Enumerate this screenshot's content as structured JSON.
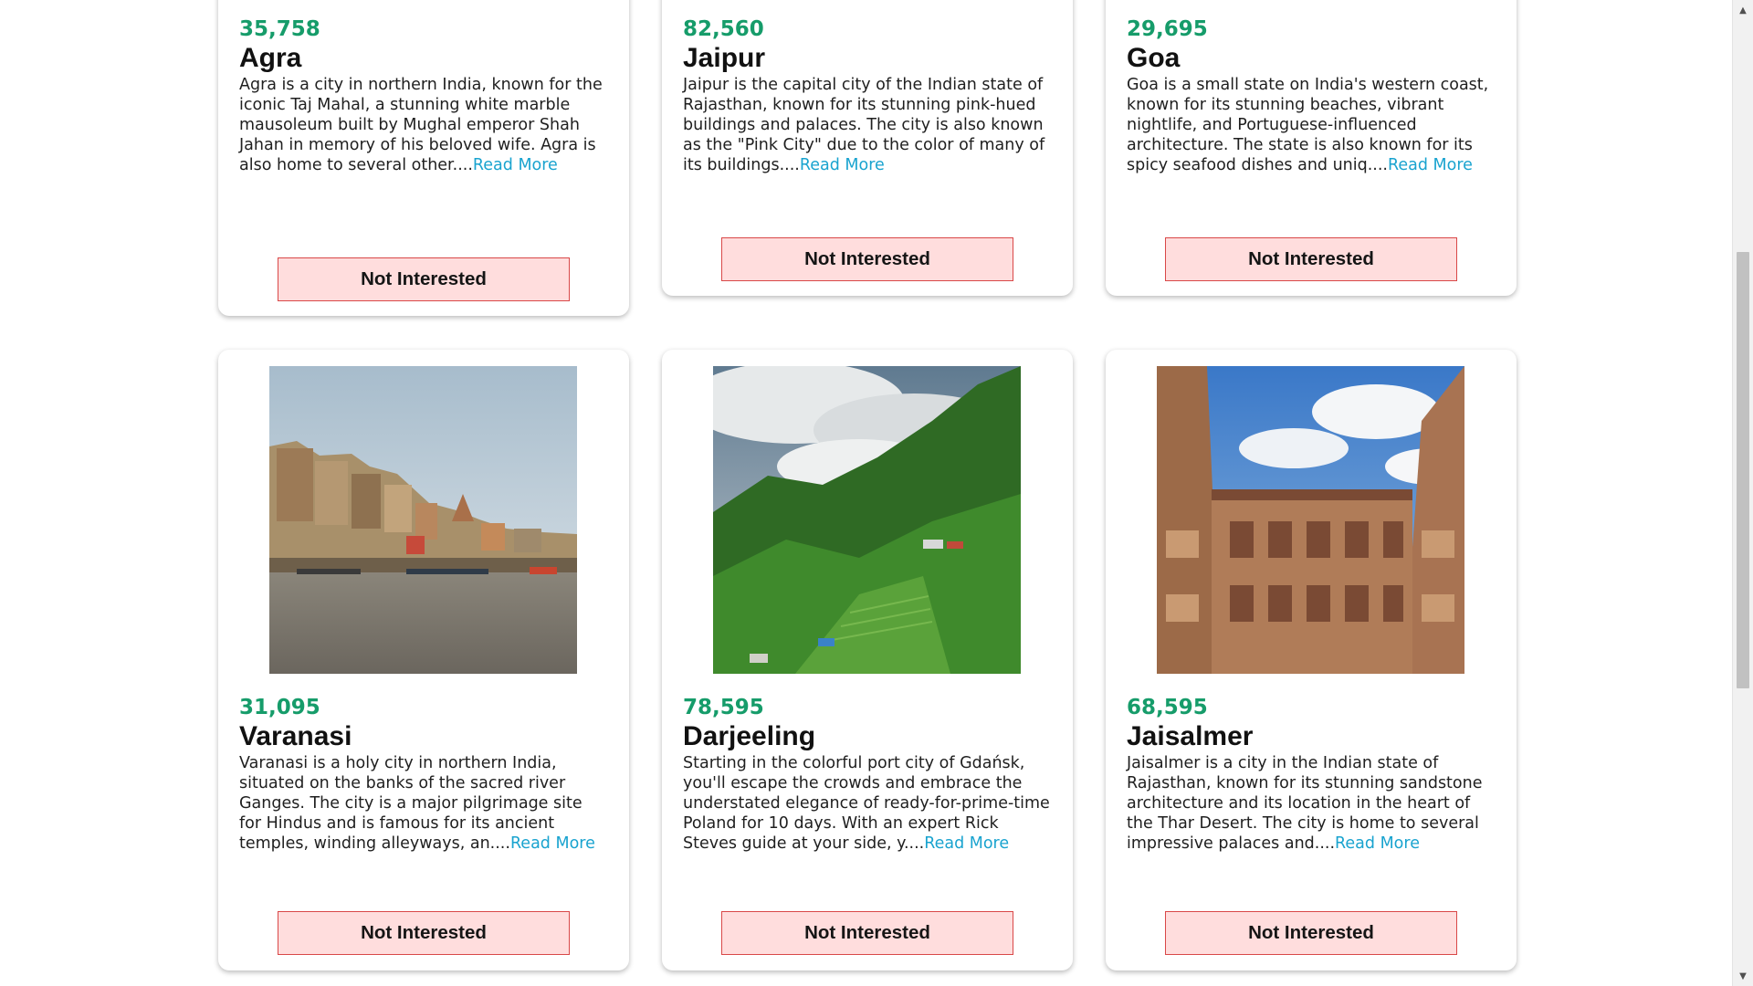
{
  "cards": [
    {
      "price": "35,758",
      "city": "Agra",
      "description": "Agra is a city in northern India, known for the iconic Taj Mahal, a stunning white marble mausoleum built by Mughal emperor Shah Jahan in memory of his beloved wife. Agra is also home to several other....",
      "read_more": "Read More",
      "button": "Not Interested"
    },
    {
      "price": "82,560",
      "city": "Jaipur",
      "description": "Jaipur is the capital city of the Indian state of Rajasthan, known for its stunning pink-hued buildings and palaces. The city is also known as the \"Pink City\" due to the color of many of its buildings....",
      "read_more": "Read More",
      "button": "Not Interested"
    },
    {
      "price": "29,695",
      "city": "Goa",
      "description": "Goa is a small state on India's western coast, known for its stunning beaches, vibrant nightlife, and Portuguese-influenced architecture. The state is also known for its spicy seafood dishes and uniq....",
      "read_more": "Read More",
      "button": "Not Interested"
    },
    {
      "price": "31,095",
      "city": "Varanasi",
      "description": "Varanasi is a holy city in northern India, situated on the banks of the sacred river Ganges. The city is a major pilgrimage site for Hindus and is famous for its ancient temples, winding alleyways, an....",
      "read_more": "Read More",
      "button": "Not Interested"
    },
    {
      "price": "78,595",
      "city": "Darjeeling",
      "description": "Starting in the colorful port city of Gdańsk, you'll escape the crowds and embrace the understated elegance of ready-for-prime-time Poland for 10 days. With an expert Rick Steves guide at your side, y....",
      "read_more": "Read More",
      "button": "Not Interested"
    },
    {
      "price": "68,595",
      "city": "Jaisalmer",
      "description": "Jaisalmer is a city in the Indian state of Rajasthan, known for its stunning sandstone architecture and its location in the heart of the Thar Desert. The city is home to several impressive palaces and....",
      "read_more": "Read More",
      "button": "Not Interested"
    }
  ],
  "colors": {
    "price": "#169c6a",
    "read_more": "#19a3cf",
    "button_bg": "#ffdddd",
    "button_border": "#d94848"
  },
  "icons": {
    "scroll_up": "triangle-up-icon",
    "scroll_down": "triangle-down-icon"
  }
}
